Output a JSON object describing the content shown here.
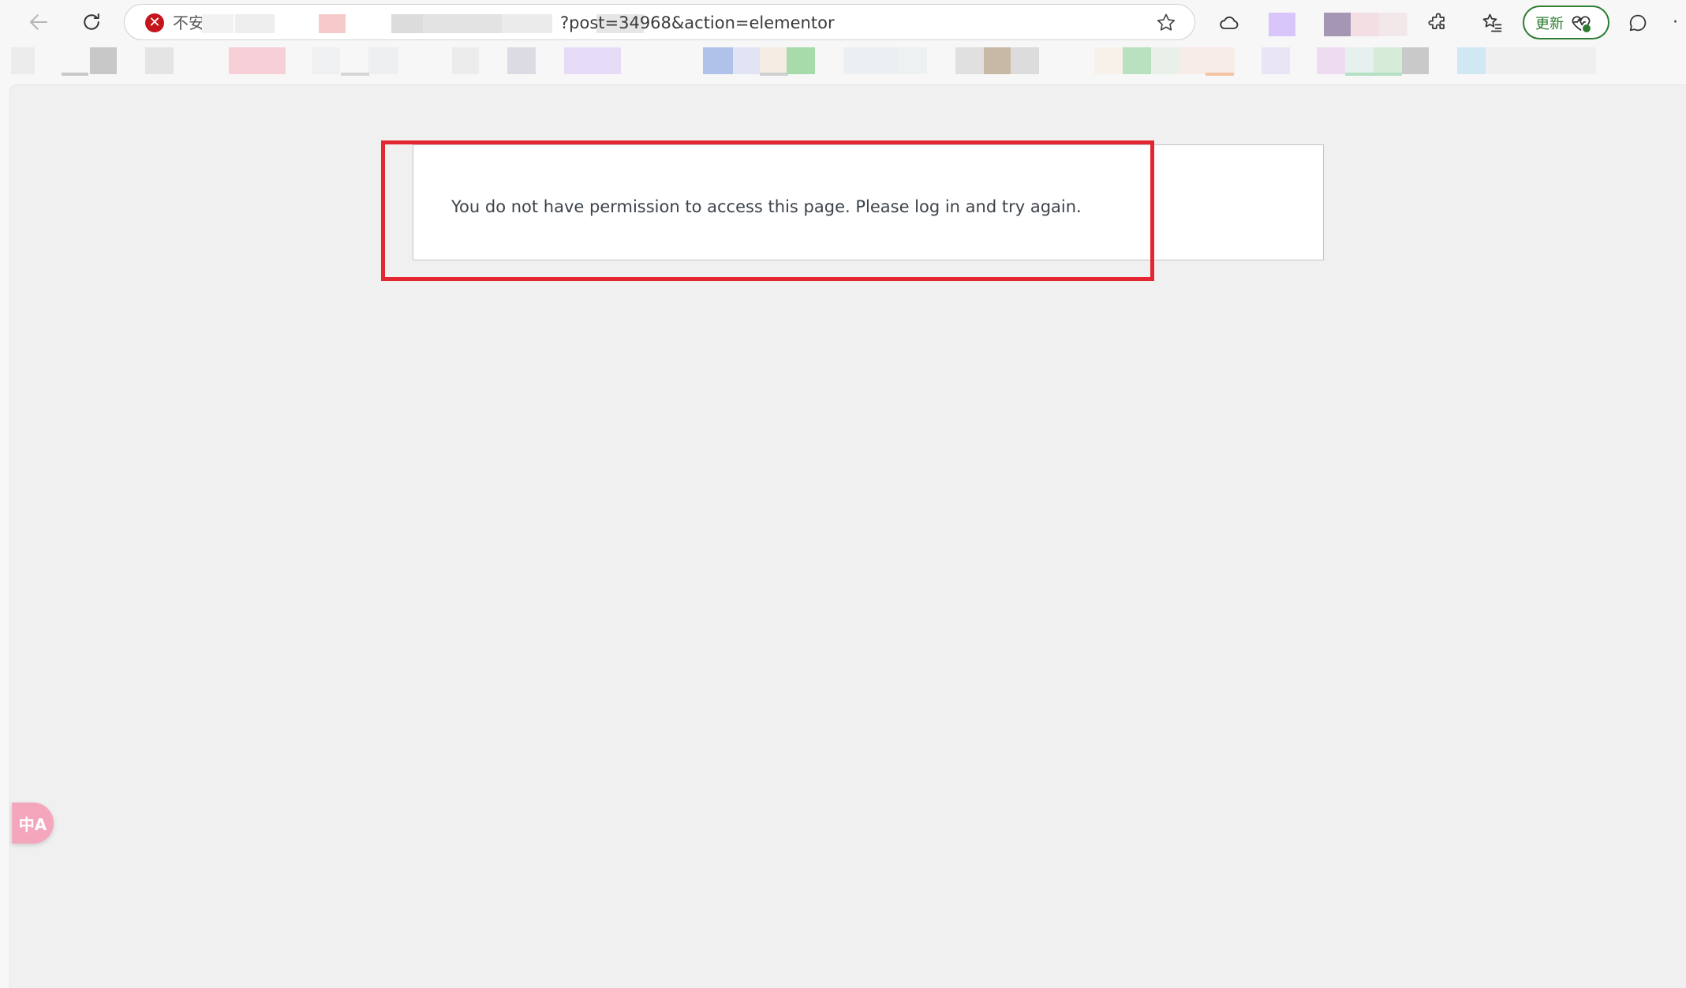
{
  "browser": {
    "address_bar": {
      "security_label": "不安",
      "url_visible": "?post=34968&action=elementor"
    },
    "update_button_label": "更新"
  },
  "page": {
    "message": "You do not have permission to access this page. Please log in and try again."
  },
  "translate_widget_label": "中A",
  "colors": {
    "highlight_border": "#e3262f",
    "update_accent": "#2e7d32",
    "security_red": "#c4141c",
    "translate_pink": "#f4a6bd",
    "page_background": "#f0f0f1"
  },
  "icons": {
    "back": "arrow-left-icon",
    "reload": "reload-icon",
    "security": "not-secure-icon",
    "favorite": "star-icon",
    "cloud": "cloud-icon",
    "extensions": "puzzle-icon",
    "favorites": "favorites-list-icon",
    "health": "heart-pulse-icon",
    "copilot": "chat-icon",
    "more": "more-icon"
  }
}
